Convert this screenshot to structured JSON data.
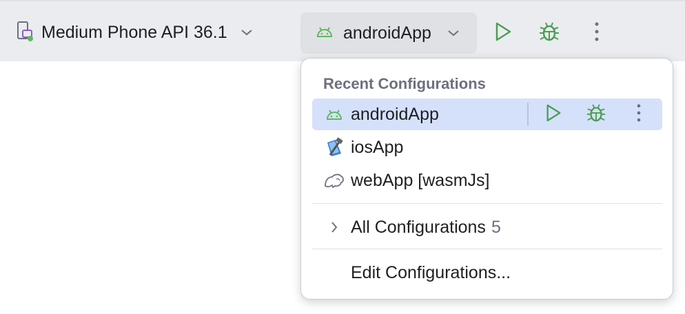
{
  "toolbar": {
    "device_label": "Medium Phone API 36.1",
    "device_icon": "device-phone-icon",
    "config_label": "androidApp",
    "config_icon": "android-icon",
    "run_icon": "run-icon",
    "debug_icon": "debug-icon",
    "more_icon": "more-vertical-icon"
  },
  "popup": {
    "section_title": "Recent Configurations",
    "recent": [
      {
        "label": "androidApp",
        "icon": "android-icon",
        "selected": true
      },
      {
        "label": "iosApp",
        "icon": "xcode-icon",
        "selected": false
      },
      {
        "label": "webApp [wasmJs]",
        "icon": "wasm-icon",
        "selected": false
      }
    ],
    "all_configurations": {
      "label": "All Configurations",
      "count": "5"
    },
    "edit_configurations": "Edit Configurations..."
  },
  "colors": {
    "toolbar_bg": "#ebecf0",
    "selected_bg": "#d5e1fb",
    "run_green": "#4b9e52",
    "android_green": "#5fb85f",
    "muted_text": "#6c707e"
  }
}
